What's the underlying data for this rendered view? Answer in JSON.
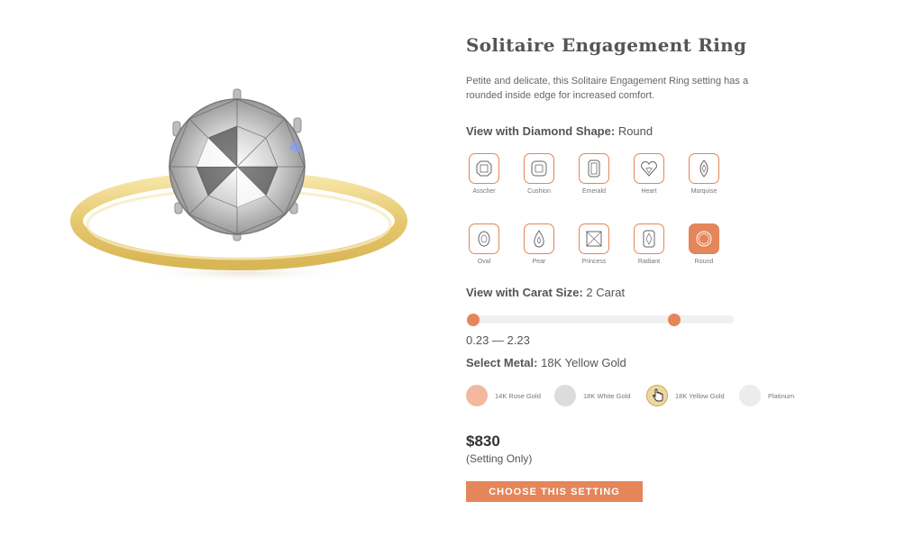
{
  "product": {
    "title": "Solitaire Engagement Ring",
    "description": "Petite and delicate, this Solitaire Engagement Ring setting has a rounded inside edge for increased comfort."
  },
  "shape_section": {
    "label": "View with Diamond Shape:",
    "value": "Round",
    "shapes": [
      {
        "label": "Asscher",
        "icon": "asscher-diamond-icon",
        "selected": false
      },
      {
        "label": "Cushion",
        "icon": "cushion-diamond-icon",
        "selected": false
      },
      {
        "label": "Emerald",
        "icon": "emerald-diamond-icon",
        "selected": false
      },
      {
        "label": "Heart",
        "icon": "heart-diamond-icon",
        "selected": false
      },
      {
        "label": "Marquise",
        "icon": "marquise-diamond-icon",
        "selected": false
      },
      {
        "label": "Oval",
        "icon": "oval-diamond-icon",
        "selected": false
      },
      {
        "label": "Pear",
        "icon": "pear-diamond-icon",
        "selected": false
      },
      {
        "label": "Princess",
        "icon": "princess-diamond-icon",
        "selected": false
      },
      {
        "label": "Radiant",
        "icon": "radiant-diamond-icon",
        "selected": false
      },
      {
        "label": "Round",
        "icon": "round-diamond-icon",
        "selected": true
      }
    ]
  },
  "carat_section": {
    "label": "View with Carat Size:",
    "value": "2 Carat",
    "range_text": "0.23 — 2.23",
    "range_min": 0.23,
    "range_max": 2.23
  },
  "metal_section": {
    "label": "Select Metal:",
    "value": "18K Yellow Gold",
    "options": [
      {
        "label": "14K Rose Gold",
        "color": "#f2b9a0",
        "selected": false
      },
      {
        "label": "18K White Gold",
        "color": "#dcdcdc",
        "selected": false
      },
      {
        "label": "18K Yellow Gold",
        "color": "#ecd9a0",
        "selected": true
      },
      {
        "label": "Platinum",
        "color": "#ececec",
        "selected": false
      }
    ]
  },
  "pricing": {
    "price": "$830",
    "note": "(Setting Only)"
  },
  "cta": {
    "label": "CHOOSE THIS SETTING"
  },
  "colors": {
    "accent": "#e5855a",
    "band_gold": "#e8cf7a"
  }
}
